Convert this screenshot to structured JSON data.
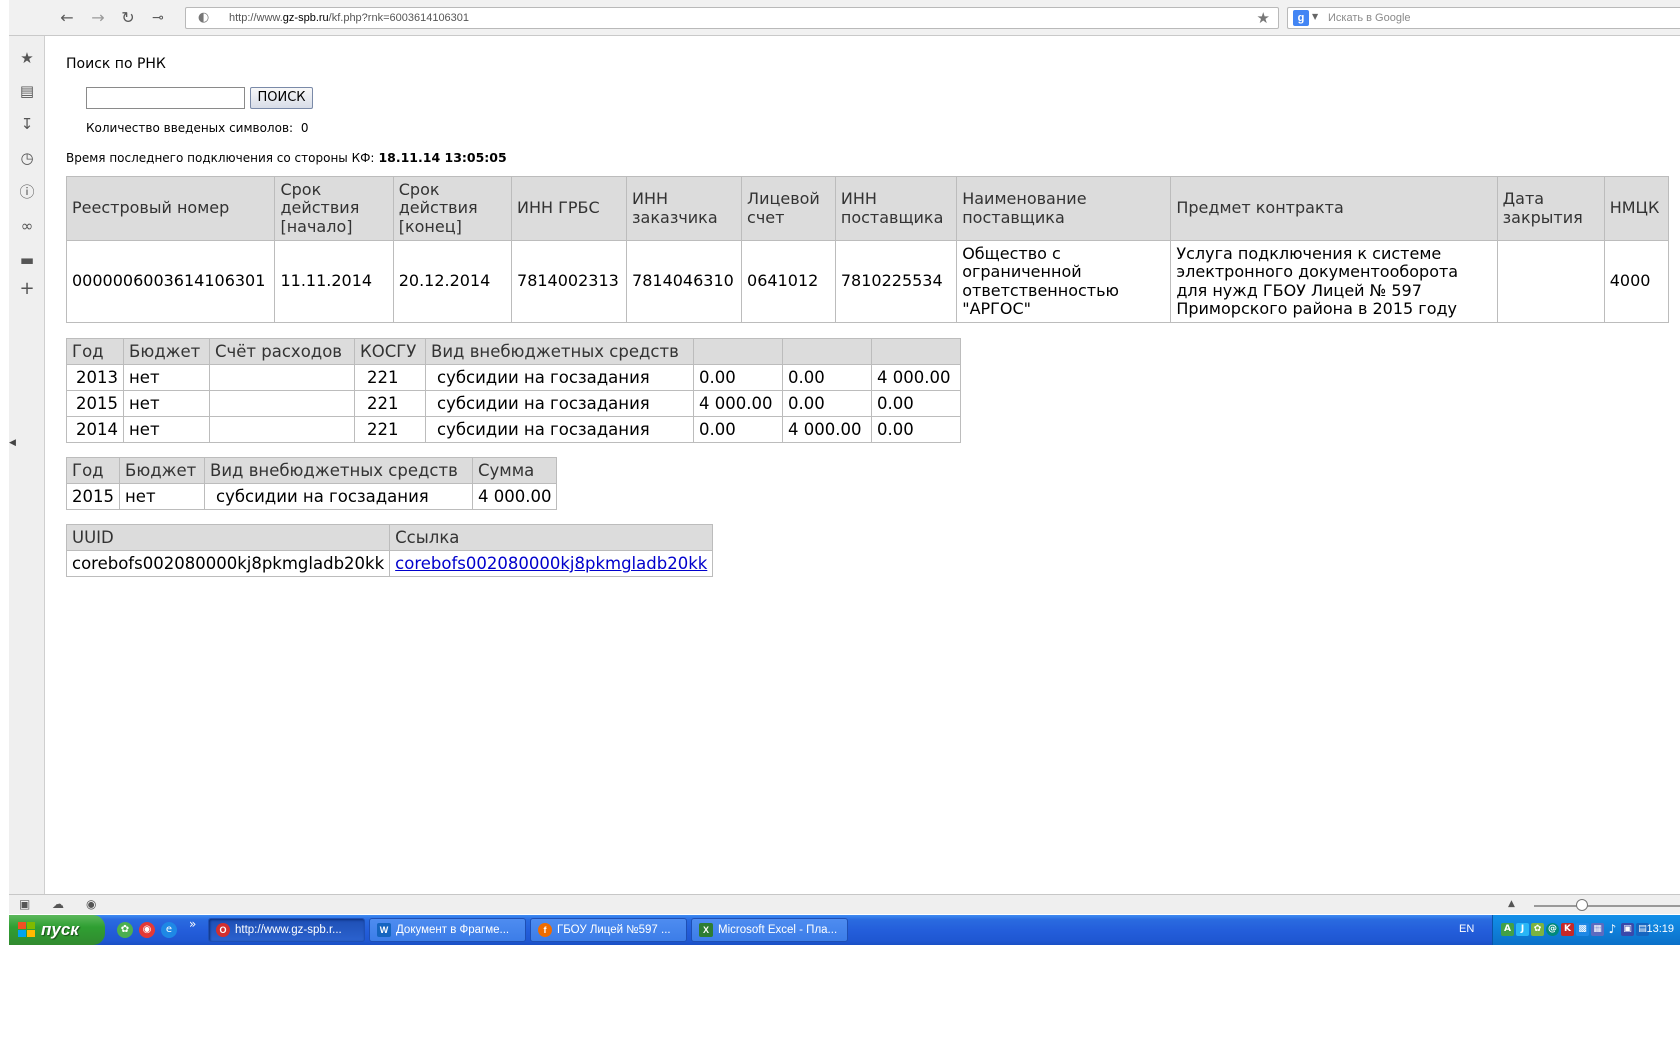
{
  "browser": {
    "url_prefix": "http://www.",
    "url_domain": "gz-spb.ru",
    "url_path": "/kf.php?rnk=6003614106301",
    "search_placeholder": "Искать в Google"
  },
  "page": {
    "title": "Поиск по РНК",
    "search_input_value": "",
    "search_button": "ПОИСК",
    "char_count_label": "Количество введеных символов:",
    "char_count_value": "0",
    "last_conn_label": "Время последнего подключения со стороны КФ:",
    "last_conn_value": "18.11.14 13:05:05"
  },
  "contract_table": {
    "headers": [
      "Реестровый номер",
      "Срок действия [начало]",
      "Срок действия [конец]",
      "ИНН ГРБС",
      "ИНН заказчика",
      "Лицевой счет",
      "ИНН поставщика",
      "Наименование поставщика",
      "Предмет контракта",
      "Дата закрытия",
      "НМЦК"
    ],
    "row": [
      "0000006003614106301",
      "11.11.2014",
      "20.12.2014",
      "7814002313",
      "7814046310",
      "0641012",
      "7810225534",
      "Общество с ограниченной ответственностью \"АРГОС\"",
      "Услуга подключения к системе электронного документооборота для нужд ГБОУ Лицей № 597 Приморского района в 2015 году",
      "",
      "4000"
    ]
  },
  "finance_table": {
    "headers": [
      "Год",
      "Бюджет",
      "Счёт расходов",
      "КОСГУ",
      "Вид внебюджетных средств",
      "",
      "",
      ""
    ],
    "rows": [
      [
        "2013",
        "нет",
        "",
        "221",
        "субсидии на госзадания",
        "0.00",
        "0.00",
        "4 000.00"
      ],
      [
        "2015",
        "нет",
        "",
        "221",
        "субсидии на госзадания",
        "4 000.00",
        "0.00",
        "0.00"
      ],
      [
        "2014",
        "нет",
        "",
        "221",
        "субсидии на госзадания",
        "0.00",
        "4 000.00",
        "0.00"
      ]
    ]
  },
  "sum_table": {
    "headers": [
      "Год",
      "Бюджет",
      "Вид внебюджетных средств",
      "Сумма"
    ],
    "rows": [
      [
        "2015",
        "нет",
        "субсидии на госзадания",
        "4 000.00"
      ]
    ]
  },
  "uuid_table": {
    "headers": [
      "UUID",
      "Ссылка"
    ],
    "uuid": "corebofs002080000kj8pkmgladb20kk",
    "link": "corebofs002080000kj8pkmgladb20kk"
  },
  "taskbar": {
    "start_label": "пуск",
    "tasks": [
      "http://www.gz-spb.r...",
      "Документ в Фрагме...",
      "ГБОУ Лицей №597 ...",
      "Microsoft Excel - Пла..."
    ],
    "lang": "EN",
    "clock": "13:19",
    "chevron": "»"
  }
}
